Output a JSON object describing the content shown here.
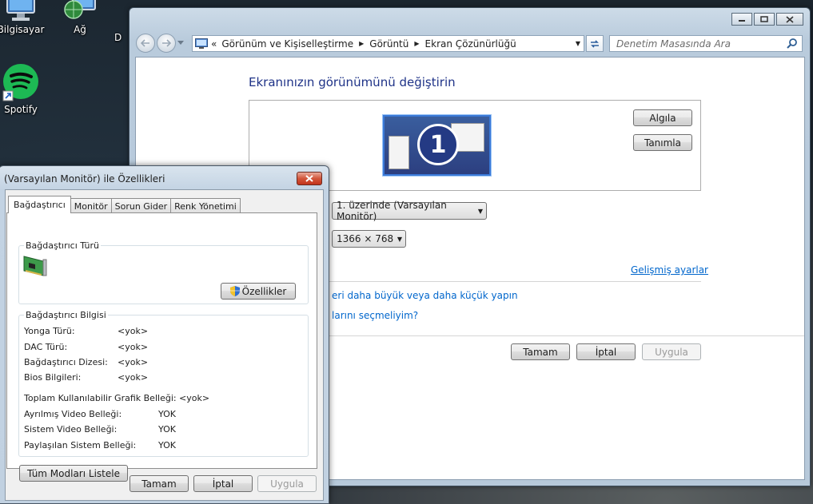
{
  "desktop": {
    "icons": [
      {
        "label": "Bilgisayar"
      },
      {
        "label": "Ağ"
      },
      {
        "label": "Spotify"
      },
      {
        "label": "D"
      }
    ]
  },
  "control_panel": {
    "address": {
      "lead": "«",
      "crumbs": [
        "Görünüm ve Kişiselleştirme",
        "Görüntü",
        "Ekran Çözünürlüğü"
      ]
    },
    "search_placeholder": "Denetim Masasında Ara",
    "heading": "Ekranınızın görünümünü değiştirin",
    "monitor_number": "1",
    "detect_label": "Algıla",
    "identify_label": "Tanımla",
    "display_value": "1. üzerinde (Varsayılan Monitör)",
    "resolution_value": "1366 × 768",
    "advanced_link": "Gelişmiş ayarlar",
    "text_size_link": "eri daha büyük veya daha küçük yapın",
    "which_link": "larını seçmeliyim?",
    "ok_label": "Tamam",
    "cancel_label": "İptal",
    "apply_label": "Uygula"
  },
  "dialog": {
    "title": "(Varsayılan Monitör) ile  Özellikleri",
    "tabs": [
      "Bağdaştırıcı",
      "Monitör",
      "Sorun Gider",
      "Renk Yönetimi"
    ],
    "adapter_type_group": "Bağdaştırıcı Türü",
    "properties_label": "Özellikler",
    "adapter_info_group": "Bağdaştırıcı Bilgisi",
    "rows": [
      {
        "label": "Yonga Türü:",
        "value": "<yok>"
      },
      {
        "label": "DAC Türü:",
        "value": "<yok>"
      },
      {
        "label": "Bağdaştırıcı Dizesi:",
        "value": "<yok>"
      },
      {
        "label": "Bios Bilgileri:",
        "value": "<yok>"
      }
    ],
    "memory_rows": [
      {
        "label": "Toplam Kullanılabilir Grafik Belleği:",
        "value": "<yok>"
      },
      {
        "label": "Ayrılmış Video Belleği:",
        "value": "YOK"
      },
      {
        "label": "Sistem Video Belleği:",
        "value": "YOK"
      },
      {
        "label": "Paylaşılan Sistem Belleği:",
        "value": "YOK"
      }
    ],
    "list_all_modes_label": "Tüm Modları Listele",
    "ok_label": "Tamam",
    "cancel_label": "İptal",
    "apply_label": "Uygula"
  }
}
